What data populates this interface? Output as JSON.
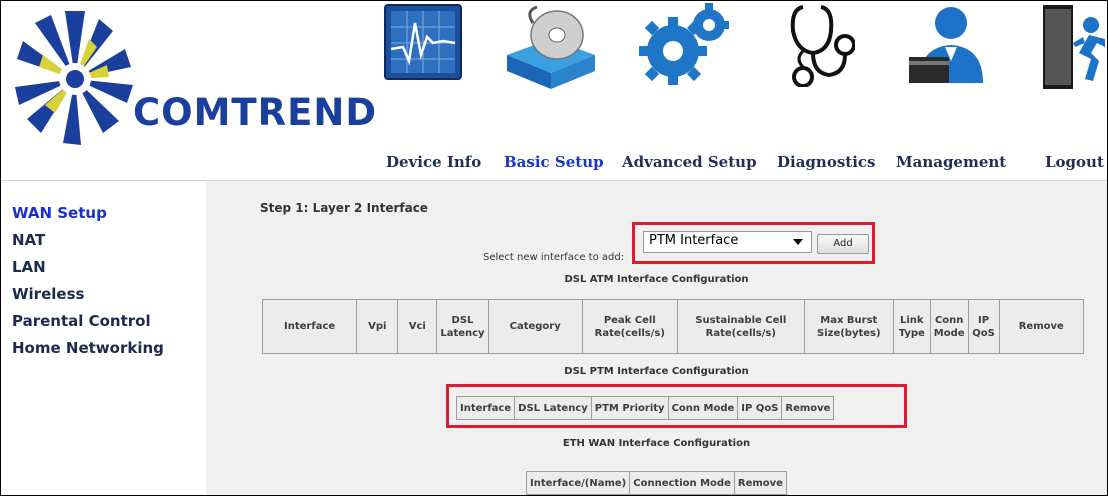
{
  "brand": {
    "name": "COMTREND",
    "color": "#1b3f9c"
  },
  "nav": [
    {
      "label": "Device Info",
      "icon": "monitor-chart-icon"
    },
    {
      "label": "Basic Setup",
      "icon": "disc-box-icon",
      "active": true
    },
    {
      "label": "Advanced Setup",
      "icon": "gears-icon"
    },
    {
      "label": "Diagnostics",
      "icon": "stethoscope-icon"
    },
    {
      "label": "Management",
      "icon": "admin-user-icon"
    },
    {
      "label": "Logout",
      "icon": "exit-door-icon"
    }
  ],
  "sidebar": {
    "items": [
      {
        "label": "WAN Setup",
        "active": true
      },
      {
        "label": "NAT"
      },
      {
        "label": "LAN"
      },
      {
        "label": "Wireless"
      },
      {
        "label": "Parental Control"
      },
      {
        "label": "Home Networking"
      }
    ]
  },
  "main": {
    "step_title": "Step 1: Layer 2 Interface",
    "select_label": "Select new interface to add:",
    "select_value": "PTM Interface",
    "add_button": "Add",
    "highlight_color": "#dd1c34",
    "atm": {
      "title": "DSL ATM Interface Configuration",
      "columns": [
        "Interface",
        "Vpi",
        "Vci",
        "DSL Latency",
        "Category",
        "Peak Cell Rate(cells/s)",
        "Sustainable Cell Rate(cells/s)",
        "Max Burst Size(bytes)",
        "Link Type",
        "Conn Mode",
        "IP QoS",
        "Remove"
      ]
    },
    "ptm": {
      "title": "DSL PTM Interface Configuration",
      "columns": [
        "Interface",
        "DSL Latency",
        "PTM Priority",
        "Conn Mode",
        "IP QoS",
        "Remove"
      ]
    },
    "eth": {
      "title": "ETH WAN Interface Configuration",
      "columns": [
        "Interface/(Name)",
        "Connection Mode",
        "Remove"
      ]
    }
  }
}
